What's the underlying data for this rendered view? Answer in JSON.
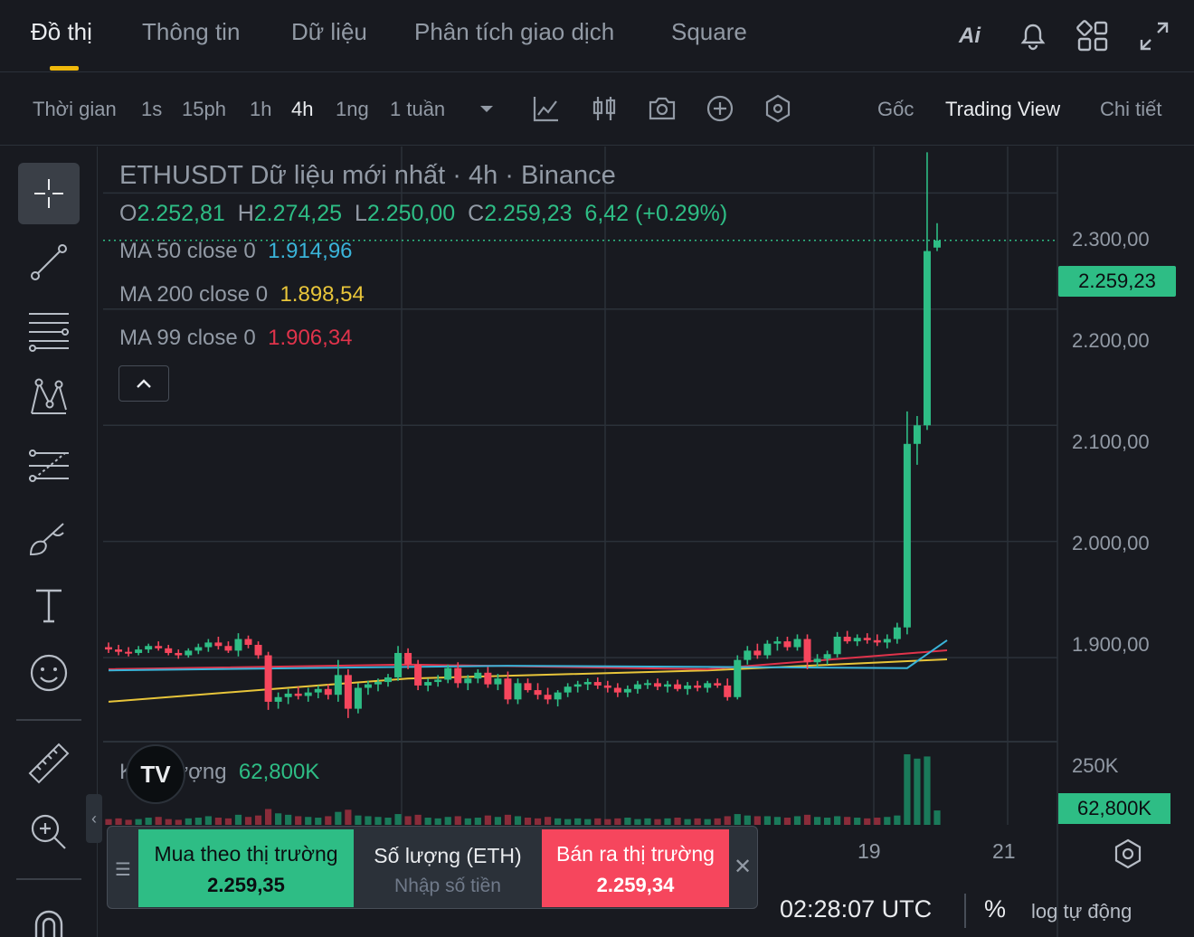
{
  "top_tabs": [
    "Đồ thị",
    "Thông tin",
    "Dữ liệu",
    "Phân tích giao dịch",
    "Square"
  ],
  "toolbar": {
    "time_label": "Thời gian",
    "intervals": [
      "1s",
      "15ph",
      "1h",
      "4h",
      "1ng",
      "1 tuần"
    ],
    "active_interval": "4h",
    "views": [
      "Gốc",
      "Trading View",
      "Chi tiết"
    ],
    "active_view": "Trading View"
  },
  "legend": {
    "title": "ETHUSDT Dữ liệu mới nhất · 4h · Binance",
    "o_label": "O",
    "o": "2.252,81",
    "h_label": "H",
    "h": "2.274,25",
    "l_label": "L",
    "l": "2.250,00",
    "c_label": "C",
    "c": "2.259,23",
    "change": "6,42 (+0.29%)",
    "ma50_label": "MA 50 close 0",
    "ma50": "1.914,96",
    "ma200_label": "MA 200 close 0",
    "ma200": "1.898,54",
    "ma99_label": "MA 99 close 0",
    "ma99": "1.906,34",
    "volume_label": "Khối lượng",
    "volume": "62,800K"
  },
  "colors": {
    "up": "#2ebd85",
    "down": "#f6465d",
    "ma50": "#3ab4d9",
    "ma200": "#e8c53a",
    "ma99": "#e0334b",
    "accent": "#f0b90b"
  },
  "price_axis": [
    "2.300,00",
    "2.200,00",
    "2.100,00",
    "2.000,00",
    "1.900,00"
  ],
  "current_price": "2.259,23",
  "volume_axis": "250K",
  "volume_tag": "62,800K",
  "x_axis": [
    "19",
    "21"
  ],
  "trade": {
    "buy_label": "Mua theo thị trường",
    "buy_price": "2.259,35",
    "qty_label": "Số lượng (ETH)",
    "qty_placeholder": "Nhập số tiền",
    "sell_label": "Bán ra thị trường",
    "sell_price": "2.259,34"
  },
  "footer": {
    "time": "02:28:07 UTC",
    "pct": "%",
    "log": "log tự động"
  },
  "chart_data": {
    "type": "candlestick",
    "ylim": [
      1830,
      2340
    ],
    "y_ticks": [
      2300,
      2200,
      2100,
      2000,
      1900
    ],
    "current": 2259.23,
    "candles": [
      [
        1909,
        1913,
        1904,
        1907
      ],
      [
        1907,
        1911,
        1902,
        1905
      ],
      [
        1905,
        1909,
        1901,
        1904
      ],
      [
        1904,
        1910,
        1902,
        1907
      ],
      [
        1907,
        1912,
        1904,
        1910
      ],
      [
        1910,
        1914,
        1906,
        1908
      ],
      [
        1908,
        1911,
        1902,
        1904
      ],
      [
        1904,
        1907,
        1899,
        1902
      ],
      [
        1902,
        1908,
        1900,
        1906
      ],
      [
        1906,
        1912,
        1903,
        1909
      ],
      [
        1909,
        1916,
        1905,
        1913
      ],
      [
        1913,
        1918,
        1907,
        1910
      ],
      [
        1910,
        1914,
        1904,
        1906
      ],
      [
        1906,
        1921,
        1901,
        1916
      ],
      [
        1916,
        1919,
        1908,
        1911
      ],
      [
        1911,
        1914,
        1899,
        1902
      ],
      [
        1902,
        1905,
        1855,
        1862
      ],
      [
        1862,
        1870,
        1856,
        1866
      ],
      [
        1866,
        1873,
        1860,
        1869
      ],
      [
        1869,
        1875,
        1864,
        1867
      ],
      [
        1867,
        1874,
        1862,
        1870
      ],
      [
        1870,
        1876,
        1865,
        1873
      ],
      [
        1873,
        1877,
        1864,
        1868
      ],
      [
        1868,
        1898,
        1862,
        1885
      ],
      [
        1885,
        1890,
        1848,
        1856
      ],
      [
        1856,
        1878,
        1852,
        1874
      ],
      [
        1874,
        1880,
        1868,
        1877
      ],
      [
        1877,
        1882,
        1871,
        1879
      ],
      [
        1879,
        1886,
        1875,
        1883
      ],
      [
        1883,
        1910,
        1880,
        1904
      ],
      [
        1904,
        1908,
        1890,
        1894
      ],
      [
        1894,
        1898,
        1872,
        1876
      ],
      [
        1876,
        1882,
        1871,
        1879
      ],
      [
        1879,
        1885,
        1875,
        1881
      ],
      [
        1881,
        1894,
        1878,
        1891
      ],
      [
        1891,
        1896,
        1874,
        1878
      ],
      [
        1878,
        1885,
        1872,
        1882
      ],
      [
        1882,
        1890,
        1878,
        1887
      ],
      [
        1887,
        1892,
        1874,
        1877
      ],
      [
        1877,
        1886,
        1872,
        1882
      ],
      [
        1882,
        1888,
        1860,
        1864
      ],
      [
        1864,
        1882,
        1860,
        1878
      ],
      [
        1878,
        1882,
        1870,
        1872
      ],
      [
        1872,
        1878,
        1864,
        1868
      ],
      [
        1868,
        1874,
        1860,
        1864
      ],
      [
        1864,
        1872,
        1858,
        1870
      ],
      [
        1870,
        1878,
        1866,
        1875
      ],
      [
        1875,
        1880,
        1870,
        1877
      ],
      [
        1877,
        1882,
        1872,
        1879
      ],
      [
        1879,
        1883,
        1873,
        1876
      ],
      [
        1876,
        1880,
        1870,
        1874
      ],
      [
        1874,
        1878,
        1866,
        1870
      ],
      [
        1870,
        1876,
        1866,
        1873
      ],
      [
        1873,
        1880,
        1869,
        1877
      ],
      [
        1877,
        1881,
        1873,
        1878
      ],
      [
        1878,
        1882,
        1872,
        1875
      ],
      [
        1875,
        1880,
        1870,
        1877
      ],
      [
        1877,
        1881,
        1871,
        1873
      ],
      [
        1873,
        1879,
        1868,
        1876
      ],
      [
        1876,
        1880,
        1871,
        1874
      ],
      [
        1874,
        1880,
        1870,
        1878
      ],
      [
        1878,
        1882,
        1874,
        1876
      ],
      [
        1876,
        1882,
        1863,
        1866
      ],
      [
        1866,
        1902,
        1864,
        1898
      ],
      [
        1898,
        1910,
        1894,
        1906
      ],
      [
        1906,
        1912,
        1899,
        1902
      ],
      [
        1902,
        1915,
        1899,
        1912
      ],
      [
        1912,
        1918,
        1906,
        1914
      ],
      [
        1914,
        1918,
        1906,
        1909
      ],
      [
        1909,
        1920,
        1906,
        1916
      ],
      [
        1916,
        1920,
        1890,
        1896
      ],
      [
        1896,
        1903,
        1892,
        1899
      ],
      [
        1899,
        1906,
        1894,
        1903
      ],
      [
        1903,
        1922,
        1900,
        1918
      ],
      [
        1918,
        1923,
        1912,
        1914
      ],
      [
        1914,
        1920,
        1910,
        1917
      ],
      [
        1917,
        1921,
        1912,
        1915
      ],
      [
        1915,
        1920,
        1910,
        1913
      ],
      [
        1913,
        1920,
        1908,
        1916
      ],
      [
        1916,
        1930,
        1912,
        1926
      ],
      [
        1926,
        2112,
        1920,
        2084
      ],
      [
        2084,
        2108,
        2066,
        2100
      ],
      [
        2100,
        2335,
        2096,
        2250
      ],
      [
        2253,
        2274,
        2250,
        2259
      ]
    ],
    "ma50": [
      [
        0,
        1889
      ],
      [
        40,
        1893
      ],
      [
        80,
        1891
      ],
      [
        84,
        1914.96
      ]
    ],
    "ma99": [
      [
        0,
        1890
      ],
      [
        30,
        1894
      ],
      [
        60,
        1890
      ],
      [
        84,
        1906.34
      ]
    ],
    "ma200": [
      [
        0,
        1862
      ],
      [
        30,
        1882
      ],
      [
        60,
        1889
      ],
      [
        84,
        1898.54
      ]
    ],
    "volume": [
      8,
      9,
      7,
      8,
      10,
      11,
      8,
      7,
      9,
      10,
      12,
      10,
      9,
      14,
      11,
      13,
      22,
      16,
      14,
      12,
      11,
      10,
      12,
      18,
      21,
      13,
      12,
      11,
      10,
      15,
      12,
      14,
      10,
      9,
      11,
      12,
      9,
      10,
      13,
      11,
      14,
      12,
      10,
      9,
      11,
      9,
      8,
      9,
      8,
      9,
      8,
      9,
      10,
      8,
      9,
      8,
      9,
      10,
      8,
      9,
      8,
      9,
      12,
      15,
      13,
      12,
      12,
      11,
      10,
      12,
      14,
      11,
      10,
      12,
      11,
      10,
      9,
      10,
      11,
      13,
      98,
      92,
      95,
      20
    ]
  }
}
